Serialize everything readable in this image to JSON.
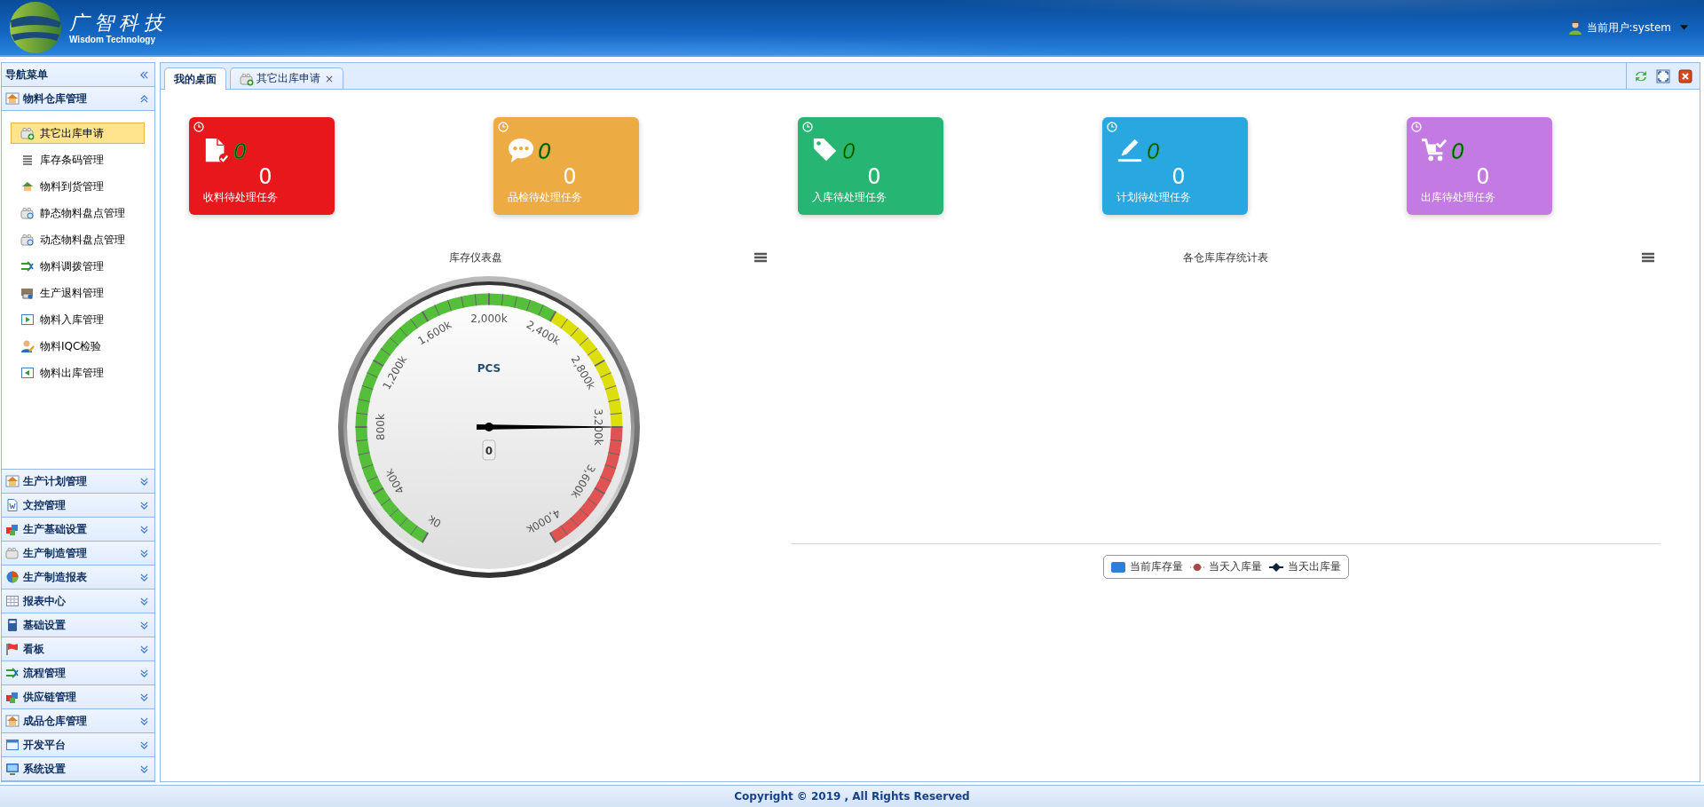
{
  "header": {
    "logo_text": "广智科技",
    "logo_subtitle": "Wisdom Technology",
    "user_label": "当前用户:system"
  },
  "sidebar": {
    "title": "导航菜单",
    "sections": [
      {
        "label": "物料仓库管理",
        "expanded": true,
        "items": [
          {
            "label": "其它出库申请",
            "selected": true
          },
          {
            "label": "库存条码管理",
            "selected": false
          },
          {
            "label": "物料到货管理",
            "selected": false
          },
          {
            "label": "静态物料盘点管理",
            "selected": false
          },
          {
            "label": "动态物料盘点管理",
            "selected": false
          },
          {
            "label": "物料调拨管理",
            "selected": false
          },
          {
            "label": "生产退料管理",
            "selected": false
          },
          {
            "label": "物料入库管理",
            "selected": false
          },
          {
            "label": "物料IQC检验",
            "selected": false
          },
          {
            "label": "物料出库管理",
            "selected": false
          }
        ]
      },
      {
        "label": "生产计划管理",
        "expanded": false
      },
      {
        "label": "文控管理",
        "expanded": false
      },
      {
        "label": "生产基础设置",
        "expanded": false
      },
      {
        "label": "生产制造管理",
        "expanded": false
      },
      {
        "label": "生产制造报表",
        "expanded": false
      },
      {
        "label": "报表中心",
        "expanded": false
      },
      {
        "label": "基础设置",
        "expanded": false
      },
      {
        "label": "看板",
        "expanded": false
      },
      {
        "label": "流程管理",
        "expanded": false
      },
      {
        "label": "供应链管理",
        "expanded": false
      },
      {
        "label": "成品仓库管理",
        "expanded": false
      },
      {
        "label": "开发平台",
        "expanded": false
      },
      {
        "label": "系统设置",
        "expanded": false
      }
    ]
  },
  "tabs": [
    {
      "label": "我的桌面",
      "selected": true
    },
    {
      "label": "其它出库申请",
      "selected": false,
      "close": "×"
    }
  ],
  "cards": [
    {
      "kind": "document",
      "color": "#e8171b",
      "badge": "0",
      "count": "0",
      "label": "收料待处理任务"
    },
    {
      "kind": "chat",
      "color": "#ecab43",
      "badge": "0",
      "count": "0",
      "label": "品检待处理任务"
    },
    {
      "kind": "tag",
      "color": "#27b574",
      "badge": "0",
      "count": "0",
      "label": "入库待处理任务"
    },
    {
      "kind": "pen",
      "color": "#29a7e1",
      "badge": "0",
      "count": "0",
      "label": "计划待处理任务"
    },
    {
      "kind": "cart",
      "color": "#c47ae3",
      "badge": "0",
      "count": "0",
      "label": "出库待处理任务"
    }
  ],
  "gauge": {
    "title": "库存仪表盘",
    "unit": "PCS",
    "value_label": "0",
    "needle": {
      "level": 0.8
    },
    "ticks": [
      "0k",
      "400k",
      "800k",
      "1,200k",
      "1,600k",
      "2,000k",
      "2,400k",
      "2,800k",
      "3,200k",
      "3,600k",
      "4,000k"
    ]
  },
  "stock_chart": {
    "title": "各仓库库存统计表",
    "legend": [
      {
        "kind": "bar",
        "label": "当前库存量",
        "color": "#2f7ed8"
      },
      {
        "kind": "line-circle",
        "label": "当天入库量",
        "color": "#aa4643"
      },
      {
        "kind": "line-diamond",
        "label": "当天出库量",
        "color": "#0d233a"
      }
    ]
  },
  "footer": {
    "text": "Copyright © 2019 , All Rights Reserved"
  }
}
